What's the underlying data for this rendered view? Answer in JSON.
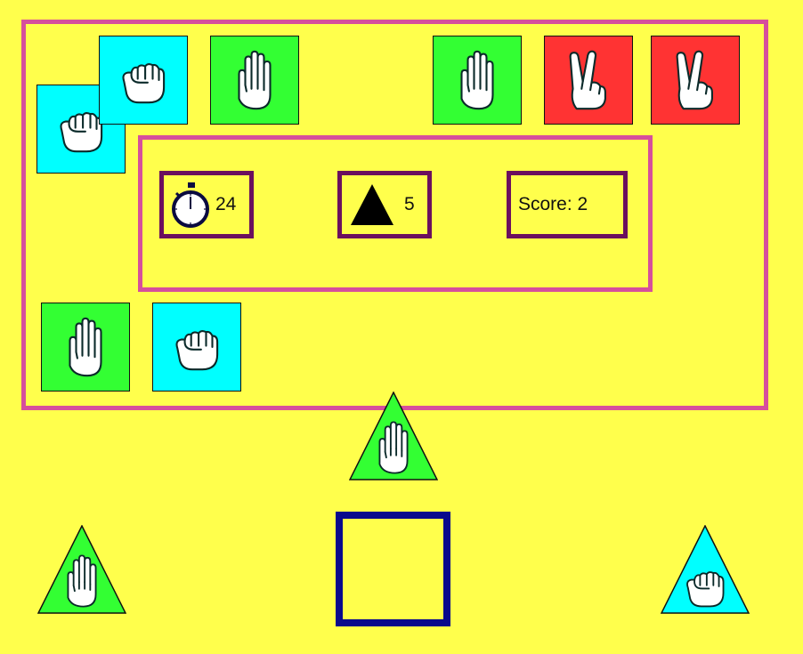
{
  "colors": {
    "background": "#ffff4c",
    "frame": "#d64f9c",
    "stat_border": "#6b0f5e",
    "target_border": "#0a0a8c",
    "rock": "#00ffff",
    "paper": "#33ff33",
    "scissors": "#ff3333"
  },
  "hud": {
    "timer_value": "24",
    "lives_value": "5",
    "score_text": "Score: 2"
  },
  "icons": {
    "timer": "stopwatch-icon",
    "lives": "triangle-icon",
    "rock": "fist-icon",
    "paper": "open-hand-icon",
    "scissors": "victory-hand-icon"
  }
}
